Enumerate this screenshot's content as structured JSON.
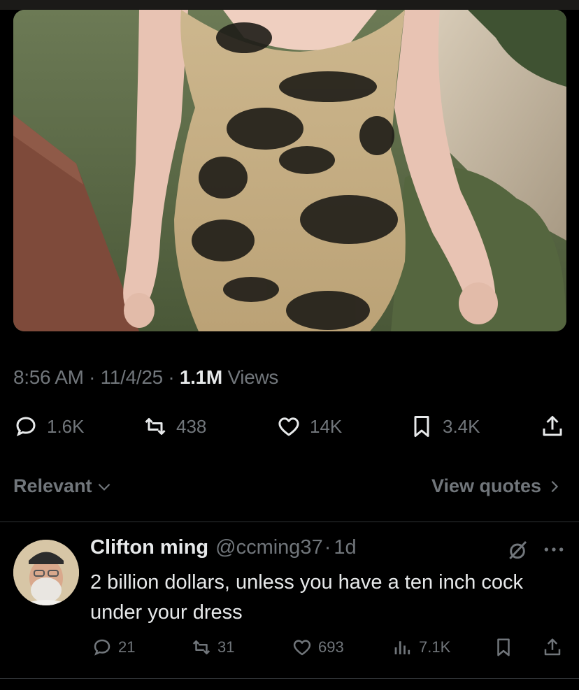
{
  "tweet": {
    "time": "8:56 AM",
    "sep1": "·",
    "date": "11/4/25",
    "sep2": "·",
    "views_count": "1.1M",
    "views_label": "Views",
    "replies": "1.6K",
    "reposts": "438",
    "likes": "14K",
    "bookmarks": "3.4K"
  },
  "sort": {
    "label": "Relevant",
    "quotes_label": "View quotes"
  },
  "reply": {
    "name": "Clifton ming",
    "handle": "@ccming37",
    "sep": "·",
    "age": "1d",
    "text": "2 billion dollars, unless you have a ten inch cock under your dress",
    "replies": "21",
    "reposts": "31",
    "likes": "693",
    "views": "7.1K"
  },
  "icons": [
    "reply-icon",
    "repost-icon",
    "like-icon",
    "bookmark-icon",
    "share-icon",
    "views-icon",
    "grok-icon",
    "more-icon",
    "chevron-down-icon",
    "chevron-right-icon"
  ],
  "colors": {
    "background": "#000000",
    "text": "#e7e9ea",
    "muted": "#71767b",
    "divider": "#2f3336"
  }
}
